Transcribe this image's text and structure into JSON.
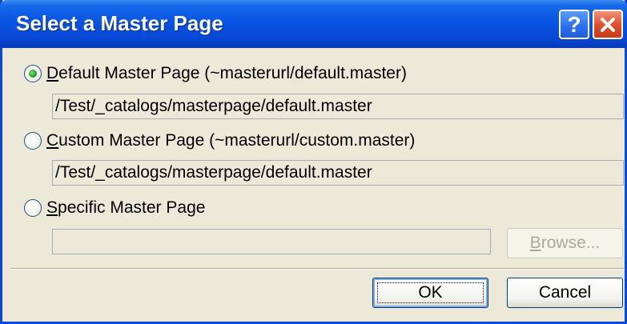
{
  "dialog": {
    "title": "Select a Master Page",
    "help_glyph": "?",
    "close_icon": "close-icon"
  },
  "options": [
    {
      "label_access": "D",
      "label_rest": "efault Master Page (~masterurl/default.master)",
      "selected": true,
      "field_value": "/Test/_catalogs/masterpage/default.master"
    },
    {
      "label_access": "C",
      "label_rest": "ustom Master Page (~masterurl/custom.master)",
      "selected": false,
      "field_value": "/Test/_catalogs/masterpage/default.master"
    },
    {
      "label_access": "S",
      "label_rest": "pecific Master Page",
      "selected": false,
      "field_value": ""
    }
  ],
  "browse": {
    "label_access": "B",
    "label_rest": "rowse...",
    "enabled": false
  },
  "buttons": {
    "ok": "OK",
    "cancel": "Cancel"
  },
  "colors": {
    "titlebar": "#0a54e3",
    "radio_selected": "#21a121",
    "close_button": "#e0522c"
  }
}
